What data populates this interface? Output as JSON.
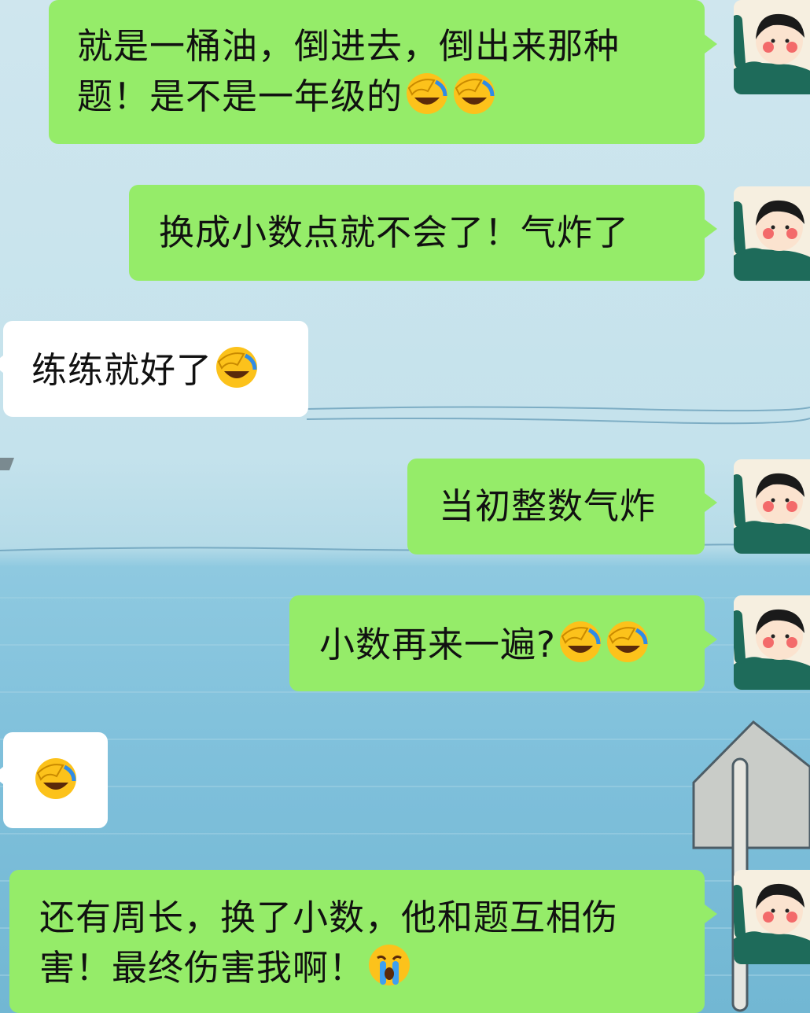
{
  "messages": [
    {
      "side": "right",
      "text": "就是一桶油，倒进去，倒出来那种题！是不是一年级的",
      "emoji": [
        "facepalm-laugh-emoji",
        "facepalm-laugh-emoji"
      ]
    },
    {
      "side": "right",
      "text": "换成小数点就不会了！气炸了",
      "emoji": []
    },
    {
      "side": "left",
      "text": "练练就好了",
      "emoji": [
        "facepalm-laugh-emoji"
      ]
    },
    {
      "side": "right",
      "text": "当初整数气炸",
      "emoji": []
    },
    {
      "side": "right",
      "text": "小数再来一遍?",
      "emoji": [
        "facepalm-laugh-emoji",
        "facepalm-laugh-emoji"
      ]
    },
    {
      "side": "left",
      "text": "",
      "emoji": [
        "facepalm-laugh-emoji"
      ]
    },
    {
      "side": "right",
      "text": "还有周长，换了小数，他和题互相伤害！最终伤害我啊！",
      "emoji": [
        "crying-emoji"
      ]
    }
  ],
  "colors": {
    "outgoing_bubble": "#95ec69",
    "incoming_bubble": "#ffffff",
    "text": "#111111"
  },
  "avatar_icon": "girl-waving-avatar"
}
